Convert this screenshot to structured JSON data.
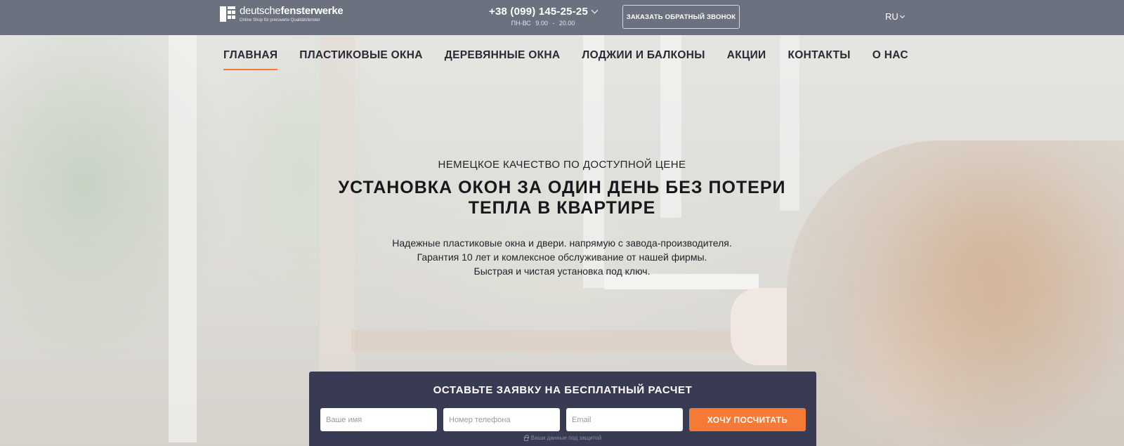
{
  "header": {
    "logo": {
      "name_regular": "deutsche",
      "name_bold": "fensterwerke",
      "tagline": "Online Shop für preiswerte Qualitätsfenster"
    },
    "phone": "+38 (099) 145-25-25",
    "hours": "ПН-ВС   9.00 - 20.00",
    "callback_label": "ЗАКАЗАТЬ ОБРАТНЫЙ ЗВОНОК",
    "language": "RU"
  },
  "nav": {
    "items": [
      {
        "label": "ГЛАВНАЯ",
        "active": true
      },
      {
        "label": "ПЛАСТИКОВЫЕ ОКНА"
      },
      {
        "label": "ДЕРЕВЯННЫЕ ОКНА"
      },
      {
        "label": "ЛОДЖИИ И БАЛКОНЫ"
      },
      {
        "label": "АКЦИИ"
      },
      {
        "label": "КОНТАКТЫ"
      },
      {
        "label": "О НАС"
      }
    ]
  },
  "hero": {
    "kicker": "НЕМЕЦКОЕ КАЧЕСТВО ПО ДОСТУПНОЙ ЦЕНЕ",
    "headline_line1": "УСТАНОВКА ОКОН ЗА ОДИН ДЕНЬ БЕЗ ПОТЕРИ",
    "headline_line2": "ТЕПЛА В КВАРТИРЕ",
    "lead": [
      "Надежные пластиковые окна и двери. напрямую с завода-производителя.",
      "Гарантия 10 лет и комлексное обслуживание от нашей фирмы.",
      "Быстрая и чистая установка под ключ."
    ]
  },
  "form": {
    "title": "ОСТАВЬТЕ ЗАЯВКУ НА БЕСПЛАТНЫЙ РАСЧЕТ",
    "name_placeholder": "Ваше имя",
    "phone_placeholder": "Номер телефона",
    "email_placeholder": "Email",
    "submit_label": "ХОЧУ ПОСЧИТАТЬ",
    "privacy_note": "Ваши данные под защитой"
  },
  "colors": {
    "accent": "#f57a35",
    "topbar": "#626776",
    "form_panel": "#32344e"
  }
}
